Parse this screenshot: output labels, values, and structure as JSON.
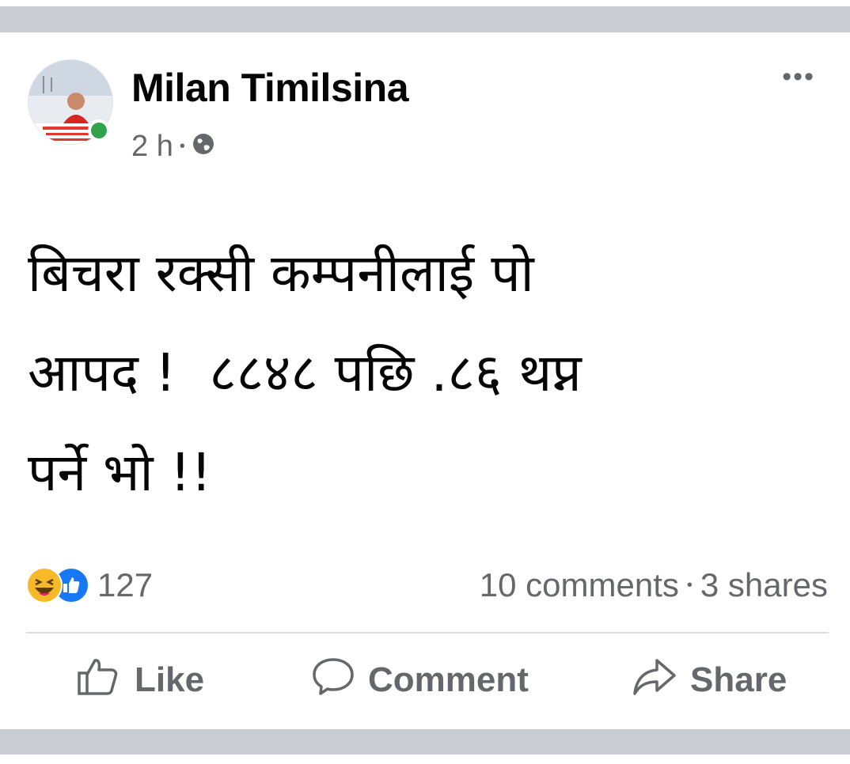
{
  "post": {
    "author": "Milan Timilsina",
    "time": "2 h",
    "meta_separator": "•",
    "privacy_icon": "globe-icon",
    "more_label": "•••",
    "text": "बिचरा रक्सी कम्पनीलाई पो\nआपद !  ८८४८ पछि .८६ थप्न\nपर्ने भो !!"
  },
  "reactions": {
    "icons": [
      "haha-emoji-icon",
      "like-reaction-icon"
    ],
    "count": "127"
  },
  "stats": {
    "comments": "10 comments",
    "separator": "•",
    "shares": "3 shares"
  },
  "actions": {
    "like": "Like",
    "comment": "Comment",
    "share": "Share"
  },
  "colors": {
    "text": "#050505",
    "secondary": "#65676b",
    "online": "#31a24c",
    "like_blue": "#1877f2",
    "haha_yellow": "#f7b928",
    "band": "#c9ccd1"
  }
}
